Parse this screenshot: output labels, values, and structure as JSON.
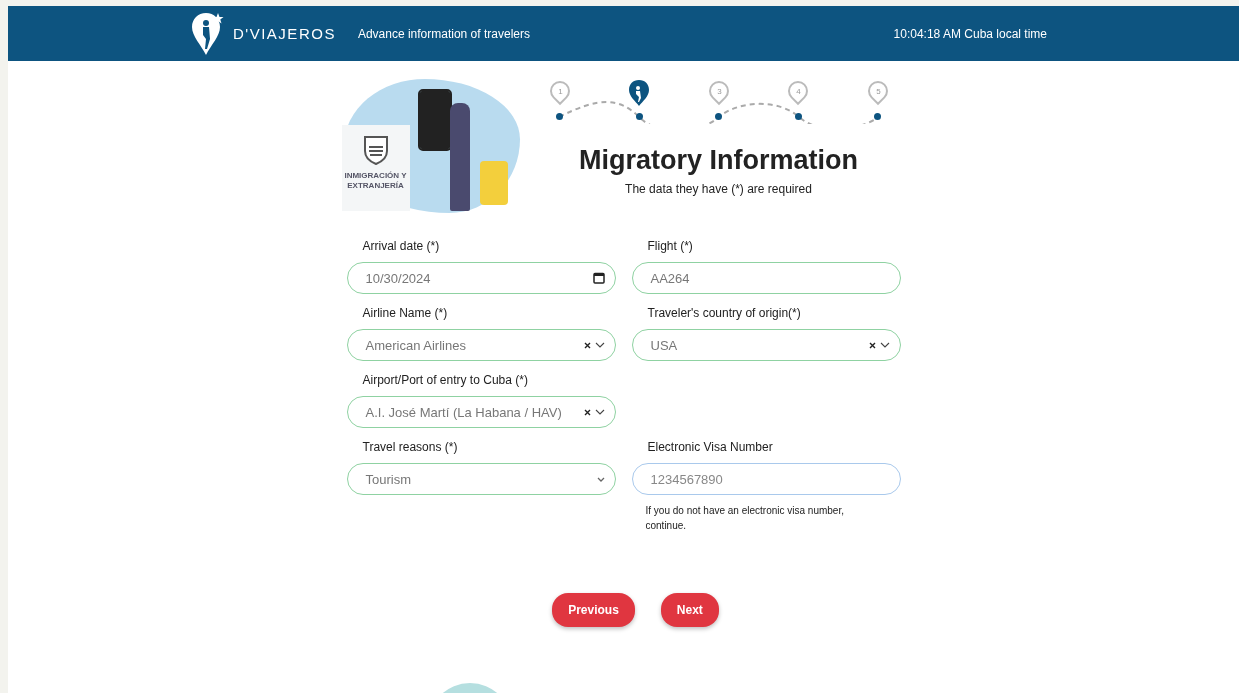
{
  "header": {
    "brand": "D'VIAJEROS",
    "subtitle": "Advance information of travelers",
    "clock": "10:04:18 AM Cuba local time"
  },
  "illustration": {
    "sign_text": "INMIGRACIÓN Y EXTRANJERÍA"
  },
  "steps": [
    {
      "label": "1",
      "selected": false
    },
    {
      "selected": true
    },
    {
      "label": "3",
      "selected": false
    },
    {
      "label": "4",
      "selected": false
    },
    {
      "label": "5",
      "selected": false
    }
  ],
  "title": "Migratory Information",
  "subtitle": "The data they have (*) are required",
  "rows": [
    {
      "fields": [
        {
          "kind": "date",
          "label": "Arrival date (*)",
          "value": "10/30/2024",
          "valid": true
        },
        {
          "kind": "text",
          "label": "Flight (*)",
          "value": "AA264",
          "valid": true
        }
      ]
    },
    {
      "fields": [
        {
          "kind": "combo",
          "label": "Airline Name (*)",
          "value": "American Airlines",
          "valid": true
        },
        {
          "kind": "combo",
          "label": "Traveler's country of origin(*)",
          "value": "USA",
          "valid": true
        }
      ]
    },
    {
      "fields": [
        {
          "kind": "combo",
          "label": "Airport/Port of entry to Cuba (*)",
          "value": "A.I. José Martí (La Habana / HAV)",
          "valid": true
        }
      ]
    },
    {
      "fields": [
        {
          "kind": "select",
          "label": "Travel reasons (*)",
          "value": "Tourism",
          "valid": true
        },
        {
          "kind": "text",
          "label": "Electronic Visa Number",
          "placeholder": "1234567890",
          "valid": false,
          "hint": "If you do not have an electronic visa number, continue."
        }
      ]
    }
  ],
  "buttons": [
    "Previous",
    "Next"
  ]
}
